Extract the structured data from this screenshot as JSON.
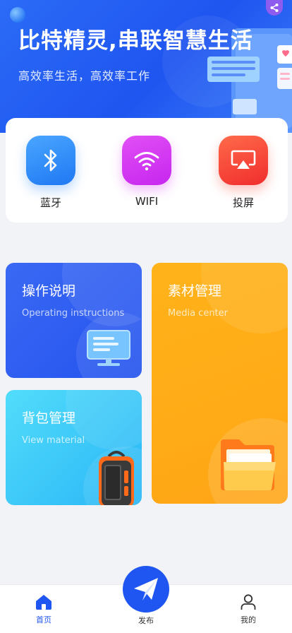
{
  "banner": {
    "title": "比特精灵,串联智慧生活",
    "subtitle": "高效率生活，高效率工作",
    "share_icon": "share-icon"
  },
  "quick_actions": [
    {
      "label": "蓝牙",
      "icon": "bluetooth-icon",
      "color": "#2b86f5"
    },
    {
      "label": "WIFI",
      "icon": "wifi-icon",
      "color": "#d533f1"
    },
    {
      "label": "投屏",
      "icon": "screen-cast-icon",
      "color": "#f5412e"
    }
  ],
  "cards": {
    "operating": {
      "title": "操作说明",
      "subtitle": "Operating instructions",
      "icon": "monitor-icon",
      "color": "#2d5ef0"
    },
    "backpack": {
      "title": "背包管理",
      "subtitle": "View material",
      "icon": "backpack-icon",
      "color": "#3cc8f8"
    },
    "media": {
      "title": "素材管理",
      "subtitle": "Media center",
      "icon": "folder-icon",
      "color": "#ffac17"
    }
  },
  "nav": {
    "home": {
      "label": "首页",
      "icon": "home-icon"
    },
    "publish": {
      "label": "发布",
      "icon": "paper-plane-icon"
    },
    "mine": {
      "label": "我的",
      "icon": "user-icon"
    }
  },
  "colors": {
    "primary": "#1f55f0",
    "background": "#f2f3f7"
  }
}
